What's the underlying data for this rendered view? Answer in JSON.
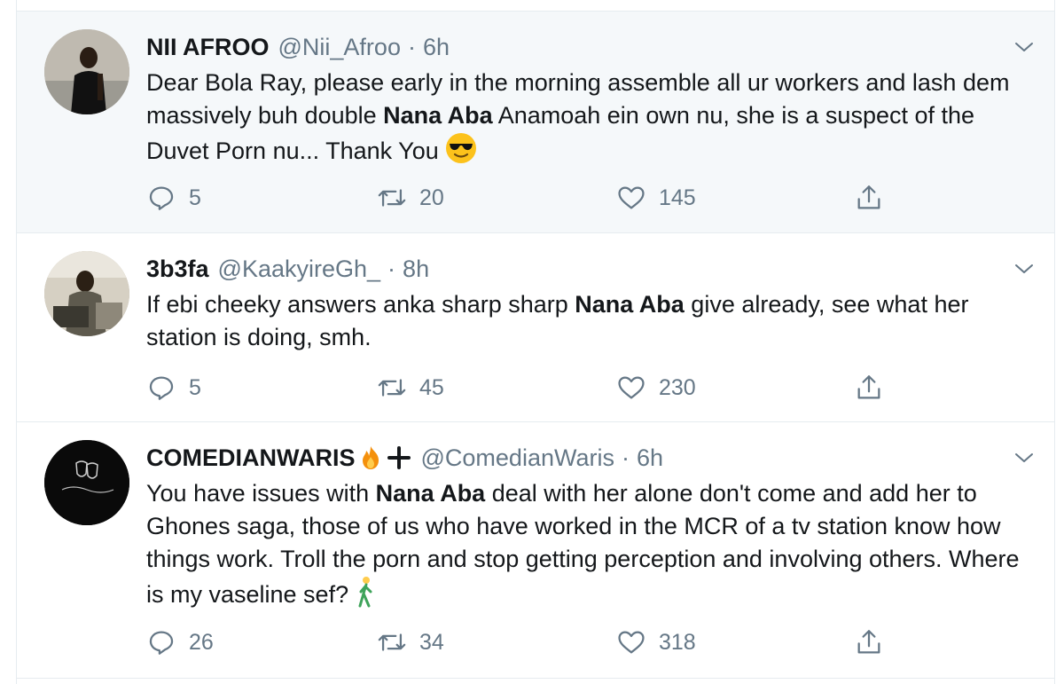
{
  "tweets": [
    {
      "display_name": "NII AFROO",
      "handle": "@Nii_Afroo",
      "separator": "·",
      "time": "6h",
      "text_parts": [
        "Dear Bola Ray, please early in the morning assemble all ur workers and lash dem massively buh double ",
        "Nana Aba",
        " Anamoah ein own nu, she is a suspect of the Duvet Porn nu... Thank You "
      ],
      "emoji": "smiling-face-with-sunglasses",
      "replies": "5",
      "retweets": "20",
      "likes": "145"
    },
    {
      "display_name": "3b3fa",
      "handle": "@KaakyireGh_",
      "separator": "·",
      "time": "8h",
      "text_parts": [
        "If ebi cheeky answers anka sharp sharp ",
        "Nana Aba",
        " give already, see what her station is doing, smh."
      ],
      "replies": "5",
      "retweets": "45",
      "likes": "230"
    },
    {
      "display_name": "COMEDIANWARIS",
      "name_emojis": [
        "fire-icon",
        "plus-icon"
      ],
      "handle": "@ComedianWaris",
      "separator": "·",
      "time": "6h",
      "text_parts": [
        "You have issues with ",
        "Nana Aba",
        " deal with her alone don't  come and add her to Ghones saga, those of us who have worked in the MCR of a tv station  know how things work. Troll the porn and stop getting  perception and involving others. Where is my vaseline sef? "
      ],
      "emoji": "person-walking",
      "replies": "26",
      "retweets": "34",
      "likes": "318"
    }
  ],
  "colors": {
    "text": "#14171a",
    "secondary": "#657786",
    "highlight_bg": "#f5f8fa",
    "border": "#e6ecf0"
  }
}
